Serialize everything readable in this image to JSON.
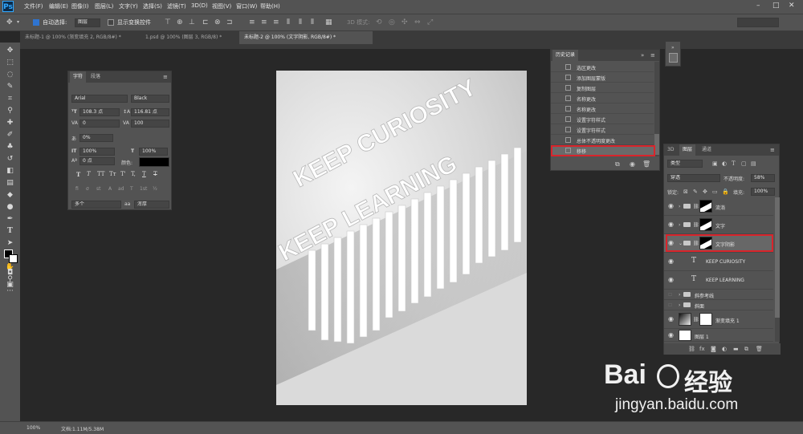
{
  "app": {
    "logo": "Ps"
  },
  "menu": [
    "文件(F)",
    "编辑(E)",
    "图像(I)",
    "图层(L)",
    "文字(Y)",
    "选择(S)",
    "滤镜(T)",
    "3D(D)",
    "视图(V)",
    "窗口(W)",
    "帮助(H)"
  ],
  "options": {
    "auto_select_label": "自动选择:",
    "auto_select_value": "图层",
    "show_transform": "显示变换控件",
    "mode_3d": "3D 模式:"
  },
  "tabs": [
    "未标题-1 @ 100% (渐变填充 2, RGB/8#) *",
    "1.psd @ 100% (图层 3, RGB/8) *",
    "未标题-2 @ 100% (文字阴影, RGB/8#) *"
  ],
  "character_panel": {
    "tab_char": "字符",
    "tab_para": "段落",
    "font": "Arial",
    "style": "Black",
    "size": "108.3 点",
    "leading": "116.81 点",
    "kerning": "0",
    "tracking": "100",
    "scale_pct": "0%",
    "vscale": "100%",
    "hscale": "100%",
    "baseline": "0 点",
    "color_label": "颜色:",
    "style_buttons": [
      "T",
      "T",
      "TT",
      "Tт",
      "T'",
      "T,",
      "T",
      "T"
    ],
    "ot_buttons": [
      "fi",
      "σ",
      "st",
      "A",
      "ad",
      "T",
      "1st",
      "½"
    ],
    "language": "多个",
    "aa": "浑厚"
  },
  "history_panel": {
    "title": "历史记录",
    "items": [
      "选区更改",
      "添加图层蒙版",
      "复制图层",
      "名称更改",
      "名称更改",
      "设置字符样式",
      "设置字符样式",
      "总体不透明度更改",
      "移移"
    ],
    "selected_index": 8
  },
  "layers_panel": {
    "tabs": [
      "3D",
      "图层",
      "通道"
    ],
    "kind": "类型",
    "blend": "穿透",
    "opacity_label": "不透明度:",
    "opacity": "58%",
    "lock_label": "锁定:",
    "fill_label": "填充:",
    "fill": "100%",
    "layers": [
      {
        "name": "流淌",
        "type": "group"
      },
      {
        "name": "文字",
        "type": "group"
      },
      {
        "name": "文字阴影",
        "type": "group",
        "selected": true
      },
      {
        "name": "KEEP CURIOSITY",
        "type": "text"
      },
      {
        "name": "KEEP LEARNING",
        "type": "text"
      },
      {
        "name": "斜参考线",
        "type": "group"
      },
      {
        "name": "斜面",
        "type": "group"
      },
      {
        "name": "渐变填充 1",
        "type": "fill"
      },
      {
        "name": "图层 1",
        "type": "pixel"
      }
    ]
  },
  "canvas_text": {
    "line1": "KEEP CURIOSITY",
    "line2": "KEEP LEARNING"
  },
  "status": {
    "zoom": "100%",
    "doc": "文档:1.11M/5.38M"
  },
  "watermark": {
    "brand": "Bai",
    "brand2": "经验",
    "url": "jingyan.baidu.com"
  },
  "colors": {
    "ui_dark": "#282828",
    "panel": "#535353",
    "highlight": "#d9242b"
  }
}
